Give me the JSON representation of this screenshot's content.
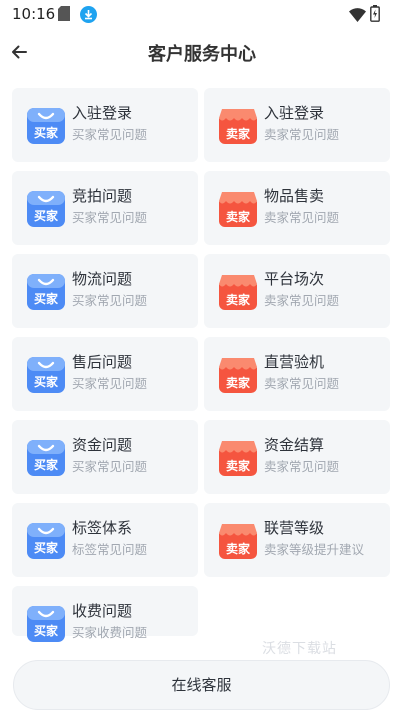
{
  "status_bar": {
    "time": "10:16"
  },
  "header": {
    "title": "客户服务中心"
  },
  "cards": [
    {
      "title": "入驻登录",
      "subtitle": "买家常见问题",
      "badge": "买家",
      "icon": "buyer-bag-icon",
      "color": "#4d8bf5"
    },
    {
      "title": "入驻登录",
      "subtitle": "卖家常见问题",
      "badge": "卖家",
      "icon": "seller-shop-icon",
      "color": "#f5553f"
    },
    {
      "title": "竞拍问题",
      "subtitle": "买家常见问题",
      "badge": "买家",
      "icon": "buyer-bag-icon",
      "color": "#4d8bf5"
    },
    {
      "title": "物品售卖",
      "subtitle": "卖家常见问题",
      "badge": "卖家",
      "icon": "seller-shop-icon",
      "color": "#f5553f"
    },
    {
      "title": "物流问题",
      "subtitle": "买家常见问题",
      "badge": "买家",
      "icon": "buyer-bag-icon",
      "color": "#4d8bf5"
    },
    {
      "title": "平台场次",
      "subtitle": "卖家常见问题",
      "badge": "卖家",
      "icon": "seller-shop-icon",
      "color": "#f5553f"
    },
    {
      "title": "售后问题",
      "subtitle": "买家常见问题",
      "badge": "买家",
      "icon": "buyer-bag-icon",
      "color": "#4d8bf5"
    },
    {
      "title": "直营验机",
      "subtitle": "卖家常见问题",
      "badge": "卖家",
      "icon": "seller-shop-icon",
      "color": "#f5553f"
    },
    {
      "title": "资金问题",
      "subtitle": "买家常见问题",
      "badge": "买家",
      "icon": "buyer-bag-icon",
      "color": "#4d8bf5"
    },
    {
      "title": "资金结算",
      "subtitle": "卖家常见问题",
      "badge": "卖家",
      "icon": "seller-shop-icon",
      "color": "#f5553f"
    },
    {
      "title": "标签体系",
      "subtitle": "标签常见问题",
      "badge": "买家",
      "icon": "buyer-bag-icon",
      "color": "#4d8bf5"
    },
    {
      "title": "联营等级",
      "subtitle": "卖家等级提升建议",
      "badge": "卖家",
      "icon": "seller-shop-icon",
      "color": "#f5553f"
    },
    {
      "title": "收费问题",
      "subtitle": "买家收费问题",
      "badge": "买家",
      "icon": "buyer-bag-icon",
      "color": "#4d8bf5"
    }
  ],
  "bottom": {
    "online_service_label": "在线客服"
  },
  "watermark": "沃德下载站"
}
